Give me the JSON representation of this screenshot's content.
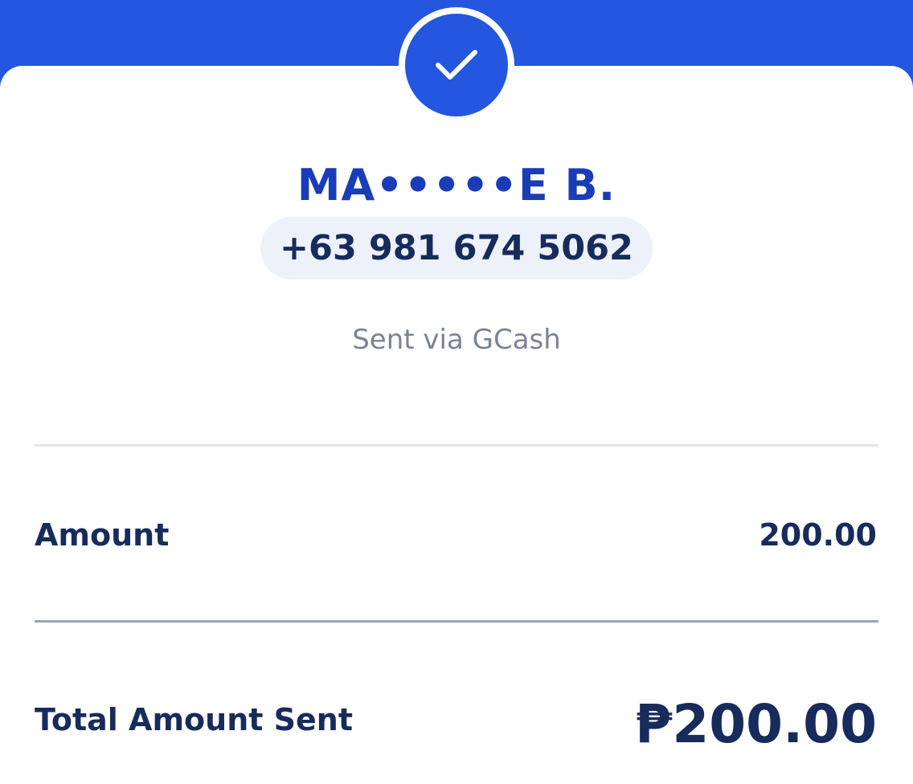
{
  "header": {
    "accent_color": "#2456DF",
    "status_icon": "check-icon"
  },
  "recipient": {
    "name": "MA•••••E B.",
    "phone": "+63 981 674 5062",
    "sent_via": "Sent via GCash"
  },
  "details": {
    "amount_label": "Amount",
    "amount_value": "200.00",
    "total_label": "Total Amount Sent",
    "total_value": "₱200.00"
  }
}
